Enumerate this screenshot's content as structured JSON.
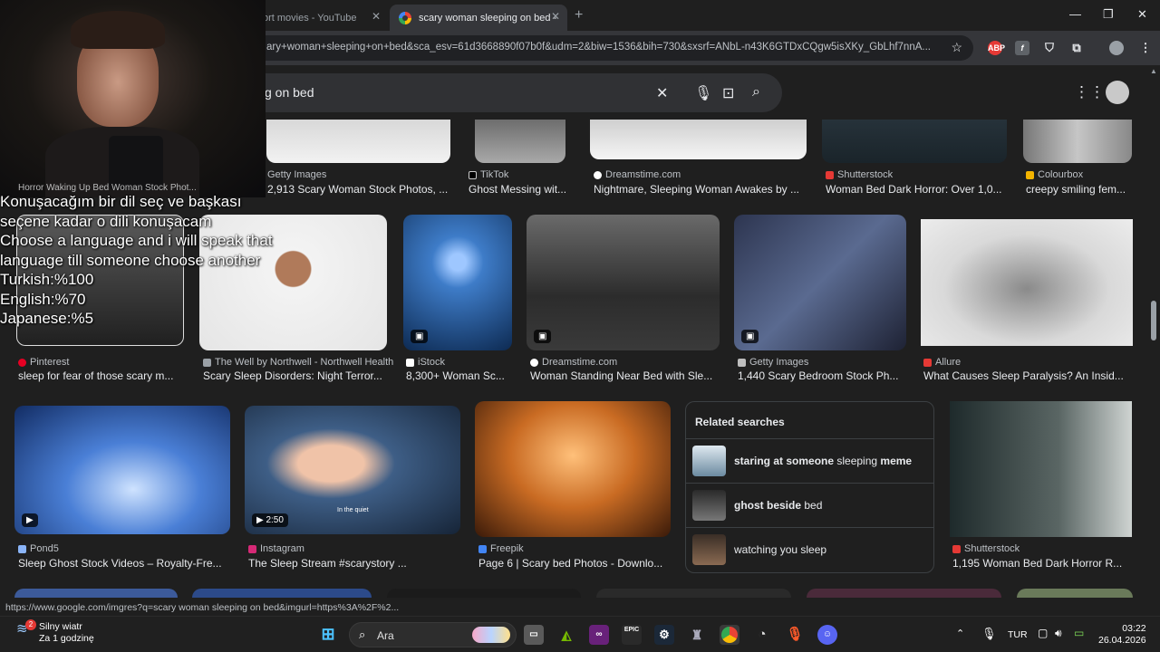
{
  "tabs": [
    {
      "label": "ort movies - YouTube"
    },
    {
      "label": "scary woman sleeping on bed -"
    }
  ],
  "address_url": "ary+woman+sleeping+on+bed&sca_esv=61d3668890f07b0f&udm=2&biw=1536&bih=730&sxsrf=ANbL-n43K6GTDxCQgw5isXKy_GbLhf7nnA...",
  "extensions": [
    "ABP",
    "f"
  ],
  "search_query": "g on bed",
  "row0": [
    {
      "source": "Getty Images",
      "title": "2,913 Scary Woman Stock Photos, ..."
    },
    {
      "source": "TikTok",
      "title": "Ghost Messing wit..."
    },
    {
      "source": "Dreamstime.com",
      "title": "Nightmare, Sleeping Woman Awakes by ..."
    },
    {
      "source": "Shutterstock",
      "title": "Woman Bed Dark Horror: Over 1,0..."
    },
    {
      "source": "Colourbox",
      "title": "creepy smiling fem..."
    }
  ],
  "row0_hidden_title": "Horror Waking Up Bed Woman Stock Phot...",
  "row1": [
    {
      "source": "Pinterest",
      "title": "sleep for fear of those scary m..."
    },
    {
      "source": "The Well by Northwell - Northwell Health",
      "title": "Scary Sleep Disorders: Night Terror..."
    },
    {
      "source": "iStock",
      "title": "8,300+ Woman Sc..."
    },
    {
      "source": "Dreamstime.com",
      "title": "Woman Standing Near Bed with Sle..."
    },
    {
      "source": "Getty Images",
      "title": "1,440 Scary Bedroom Stock Ph..."
    },
    {
      "source": "Allure",
      "title": "What Causes Sleep Paralysis? An Insid..."
    }
  ],
  "row2": [
    {
      "source": "Pond5",
      "title": "Sleep Ghost Stock Videos – Royalty-Fre..."
    },
    {
      "source": "Instagram",
      "title": "The Sleep Stream #scarystory ...",
      "duration": "2:50",
      "overlay": "In the quiet"
    },
    {
      "source": "Freepik",
      "title": "Page 6 | Scary bed Photos - Downlo..."
    },
    {
      "source": "Shutterstock",
      "title": "1,195 Woman Bed Dark Horror R..."
    }
  ],
  "related": {
    "title": "Related searches",
    "items": [
      {
        "bold1": "staring at someone",
        "normal": " sleeping ",
        "bold2": "meme"
      },
      {
        "bold1": "ghost beside",
        "normal": " bed",
        "bold2": ""
      },
      {
        "bold1": "",
        "normal": "watching you sleep",
        "bold2": ""
      }
    ]
  },
  "caption_lines": [
    "Konuşacağım bir dil seç ve başkası",
    "seçene kadar o dili konuşacam",
    "Choose a language and i will speak that",
    "language till someone choose another",
    "Turkish:%100",
    "English:%70",
    "Japanese:%5"
  ],
  "status_url": "https://www.google.com/imgres?q=scary woman sleeping on bed&imgurl=https%3A%2F%2...",
  "taskbar": {
    "weather_title": "Silny wiatr",
    "weather_sub": "Za 1 godzinę",
    "weather_badge": "2",
    "search_label": "Ara",
    "lang": "TUR",
    "time": "03:22",
    "date": "26.04.2026"
  }
}
